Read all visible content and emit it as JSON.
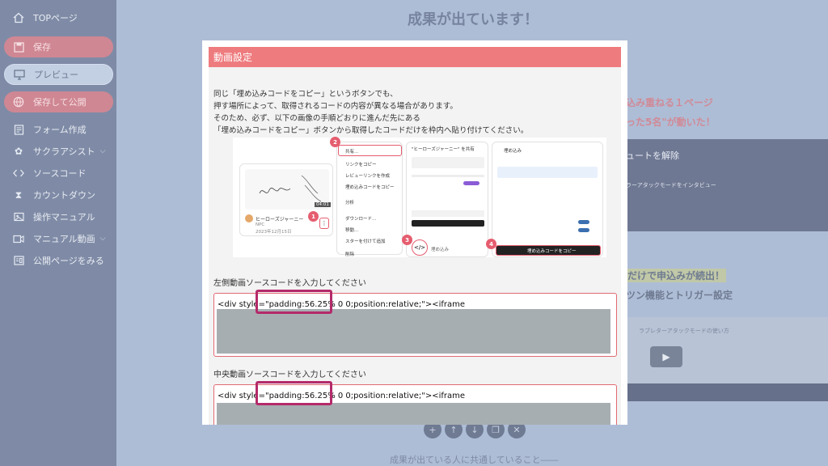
{
  "sidebar": {
    "top": "TOPページ",
    "save": "保存",
    "preview": "プレビュー",
    "publish": "保存して公開",
    "items": [
      {
        "label": "フォーム作成",
        "icon": "form-icon"
      },
      {
        "label": "サクラアシスト",
        "icon": "cherry-blossom-icon",
        "has_submenu": true
      },
      {
        "label": "ソースコード",
        "icon": "code-icon"
      },
      {
        "label": "カウントダウン",
        "icon": "hourglass-icon"
      },
      {
        "label": "操作マニュアル",
        "icon": "manual-icon"
      },
      {
        "label": "マニュアル動画",
        "icon": "video-icon",
        "has_submenu": true
      },
      {
        "label": "公開ページをみる",
        "icon": "page-icon"
      }
    ]
  },
  "background": {
    "heading": "成果が出ています！",
    "pink_line1": "込み重ねる１ページ",
    "pink_line2": "った5名\"が動いた！",
    "card_title": "ュートを解除",
    "card_sub": "ラーアタックモードをインタビュー",
    "yellow_line": "だけで申込みが続出！",
    "trigger_line": "ツン機能とトリガー設定",
    "video_title": "ラブレターアタックモードの使い方",
    "footer": "成果が出ている人に共通していること――"
  },
  "modal": {
    "title": "動画設定",
    "description": [
      "同じ「埋め込みコードをコピー」というボタンでも、",
      "押す場所によって、取得されるコードの内容が異なる場合があります。",
      "そのため、必ず、以下の画像の手順どおりに進んだ先にある",
      "「埋め込みコードをコピー」ボタンから取得したコードだけを枠内へ貼り付けてください。"
    ],
    "tutorial": {
      "video_name": "ヒーローズジャーニー",
      "video_owner": "NPC",
      "video_date": "2023年12月15日",
      "video_duration": "04:01",
      "menu_items": [
        "共有...",
        "リンクをコピー",
        "レビューリンクを作成",
        "埋め込みコードをコピー",
        "分析",
        "ダウンロード...",
        "移動...",
        "スターを付けて追加",
        "削除"
      ],
      "step3_label": "埋め込み",
      "step4_label": "埋め込みコードをコピー",
      "share_header": "\"ヒーローズジャーニー\" を共有",
      "embed_header": "埋め込み",
      "badges": [
        "1",
        "2",
        "3",
        "4"
      ]
    },
    "left_label": "左側動画ソースコードを入力してください",
    "center_label": "中央動画ソースコードを入力してください",
    "code_prefix": "<div style=\"",
    "code_highlight": "padding:56.25%",
    "code_suffix": " 0 0;position:relative;\"><iframe"
  },
  "colors": {
    "modal_header": "#ee7b7e",
    "highlight_border": "#b42a6a",
    "badge": "#e55d6f",
    "sidebar_bg": "#7f8ba6"
  }
}
